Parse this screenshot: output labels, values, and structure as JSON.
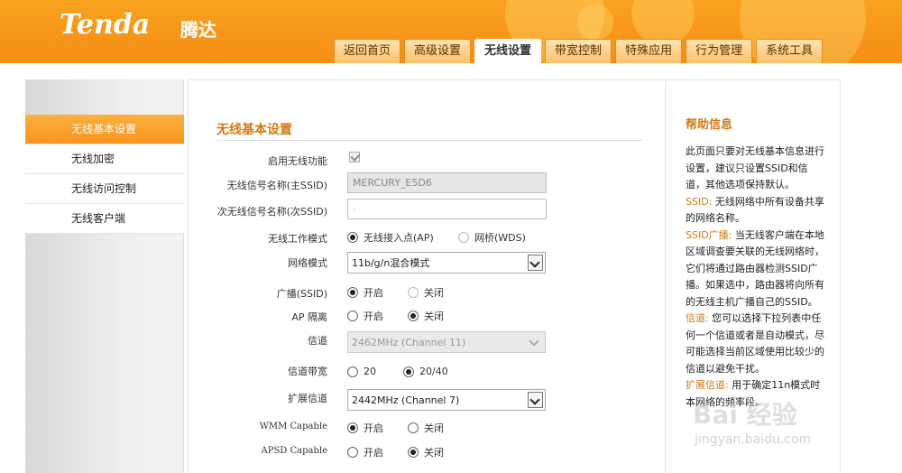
{
  "header": {
    "logo": "Tenda",
    "logo_cn": "腾达",
    "tabs": [
      "返回首页",
      "高级设置",
      "无线设置",
      "带宽控制",
      "特殊应用",
      "行为管理",
      "系统工具"
    ],
    "active_tab": "无线设置"
  },
  "sidebar": {
    "items": [
      "无线基本设置",
      "无线加密",
      "无线访问控制",
      "无线客户端"
    ],
    "active_item": "无线基本设置"
  },
  "main": {
    "title": "无线基本设置",
    "fields": {
      "enable_wireless": {
        "label": "启用无线功能",
        "checked": true
      },
      "ssid_primary": {
        "label": "无线信号名称(主SSID)",
        "value": "MERCURY_E5D6"
      },
      "ssid_secondary": {
        "label": "次无线信号名称(次SSID)",
        "value": "-"
      },
      "work_mode": {
        "label": "无线工作模式",
        "options": [
          "无线接入点(AP)",
          "网桥(WDS)"
        ],
        "selected": "无线接入点(AP)"
      },
      "network_mode": {
        "label": "网络模式",
        "value": "11b/g/n混合模式"
      },
      "broadcast": {
        "label": "广播(SSID)",
        "options": [
          "开启",
          "关闭"
        ],
        "selected": "开启"
      },
      "ap_isolation": {
        "label": "AP 隔离",
        "options": [
          "开启",
          "关闭"
        ],
        "selected": "关闭"
      },
      "channel": {
        "label": "信道",
        "value": "2462MHz (Channel 11)"
      },
      "bandwidth": {
        "label": "信道带宽",
        "options": [
          "20",
          "20/40"
        ],
        "selected": "20/40"
      },
      "ext_channel": {
        "label": "扩展信道",
        "value": "2442MHz (Channel 7)"
      },
      "wmm": {
        "label": "WMM Capable",
        "options": [
          "开启",
          "关闭"
        ],
        "selected": "开启"
      },
      "apsd": {
        "label": "APSD Capable",
        "options": [
          "开启",
          "关闭"
        ],
        "selected": "关闭"
      }
    }
  },
  "help": {
    "title": "帮助信息",
    "intro": "此页面只要对无线基本信息进行设置，建议只设置SSID和信道，其他选项保持默认。",
    "ssid_kw": "SSID:",
    "ssid_text": " 无线网络中所有设备共享的网络名称。",
    "broadcast_kw": "SSID广播:",
    "broadcast_text": " 当无线客户端在本地区域调查要关联的无线网络时，它们将通过路由器检测SSID广播。如果选中，路由器将向所有的无线主机广播自己的SSID。",
    "channel_kw": "信道:",
    "channel_text": " 您可以选择下拉列表中任何一个信道或者是自动模式，尽可能选择当前区域使用比较少的信道以避免干扰。",
    "ext_kw": "扩展信道:",
    "ext_text": " 用于确定11n模式时本网络的频率段。"
  },
  "watermark": {
    "text": "Bai 经验",
    "url": "jingyan.baidu.com"
  }
}
